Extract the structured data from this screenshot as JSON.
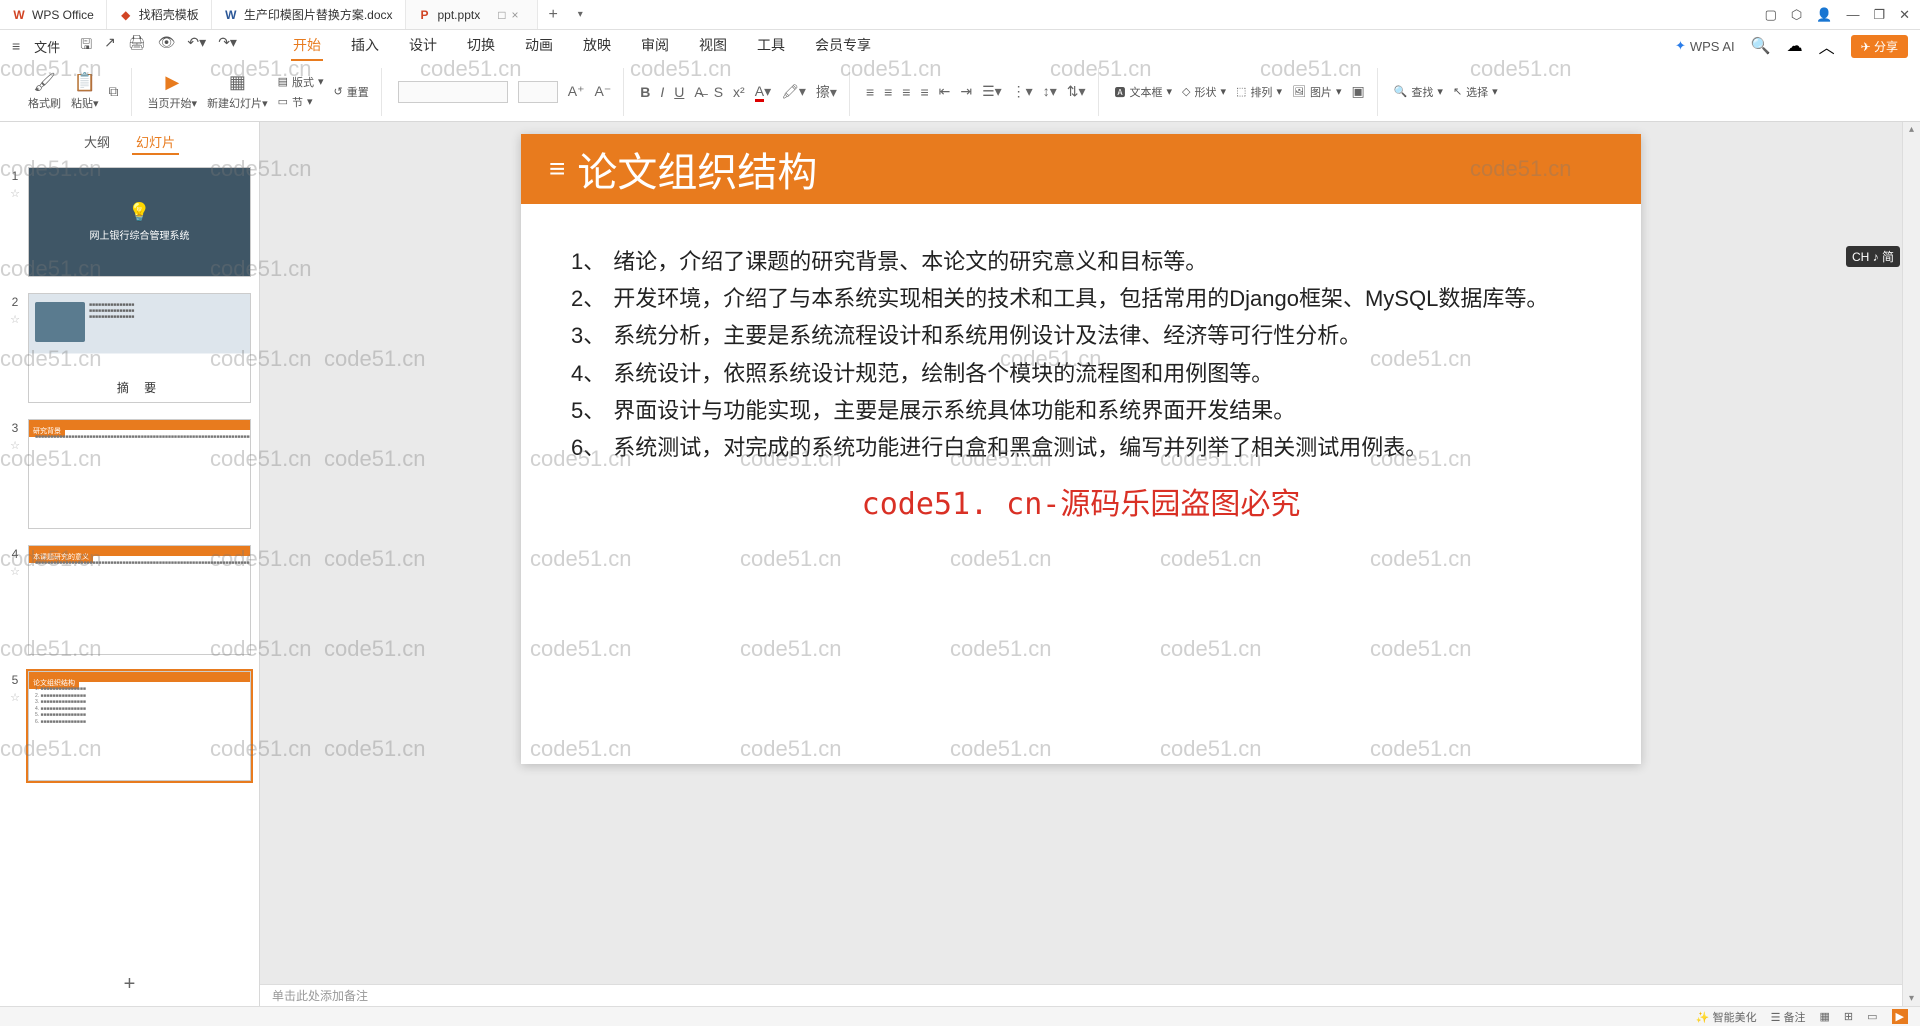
{
  "app": {
    "name": "WPS Office"
  },
  "tabs": [
    {
      "icon": "W",
      "iconColor": "#d14424",
      "label": "WPS Office"
    },
    {
      "icon": "◆",
      "iconColor": "#d14424",
      "label": "找稻壳模板"
    },
    {
      "icon": "W",
      "iconColor": "#2b5797",
      "label": "生产印模图片替换方案.docx"
    },
    {
      "icon": "P",
      "iconColor": "#d14424",
      "label": "ppt.pptx",
      "active": true,
      "window": "□"
    }
  ],
  "file_menu": "文件",
  "menu": {
    "tabs": [
      "开始",
      "插入",
      "设计",
      "切换",
      "动画",
      "放映",
      "审阅",
      "视图",
      "工具",
      "会员专享"
    ],
    "active": "开始",
    "ai": "WPS AI",
    "share": "分享"
  },
  "ribbon": {
    "format_painter": "格式刷",
    "paste": "粘贴",
    "from_current": "当页开始",
    "new_slide": "新建幻灯片",
    "layout": "版式",
    "section": "节",
    "reset": "重置",
    "textbox": "文本框",
    "shape": "形状",
    "arrange": "排列",
    "picture": "图片",
    "find": "查找",
    "select": "选择"
  },
  "thumb_tabs": {
    "outline": "大纲",
    "slides": "幻灯片"
  },
  "thumbs": {
    "t1_title": "网上银行综合管理系统",
    "t2_caption": "摘 要",
    "t3_title": "研究背景",
    "t4_title": "本课题研究的意义",
    "t5_title": "论文组织结构"
  },
  "slide": {
    "title": "论文组织结构",
    "items": [
      "绪论，介绍了课题的研究背景、本论文的研究意义和目标等。",
      "开发环境，介绍了与本系统实现相关的技术和工具，包括常用的Django框架、MySQL数据库等。",
      "系统分析，主要是系统流程设计和系统用例设计及法律、经济等可行性分析。",
      "系统设计，依照系统设计规范，绘制各个模块的流程图和用例图等。",
      "界面设计与功能实现，主要是展示系统具体功能和系统界面开发结果。",
      "系统测试，对完成的系统功能进行白盒和黑盒测试，编写并列举了相关测试用例表。"
    ],
    "watermark_center": "code51. cn-源码乐园盗图必究"
  },
  "notes_placeholder": "单击此处添加备注",
  "ime": "CH ♪ 简",
  "watermark_text": "code51.cn",
  "status": {
    "left": "",
    "right_label": "智能美化",
    "mode": "备注"
  }
}
